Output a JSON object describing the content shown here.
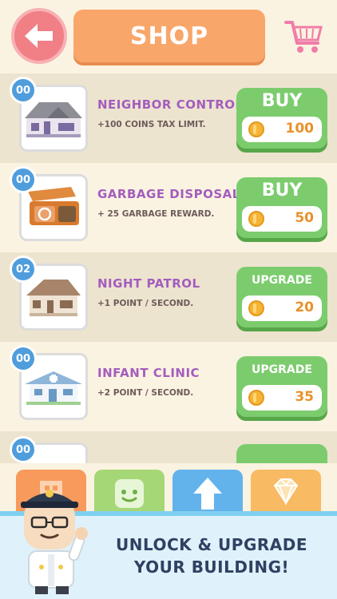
{
  "header": {
    "title": "SHOP",
    "back_icon": "arrow-left-icon",
    "cart_icon": "cart-icon"
  },
  "items": [
    {
      "count": "00",
      "name": "NEIGHBOR CONTROL",
      "desc": "+100 COINS TAX LIMIT.",
      "action": "BUY",
      "price": "100",
      "icon": "house-icon"
    },
    {
      "count": "00",
      "name": "GARBAGE DISPOSAL",
      "desc": "+ 25 GARBAGE REWARD.",
      "action": "BUY",
      "price": "50",
      "icon": "dumpster-icon"
    },
    {
      "count": "02",
      "name": "NIGHT PATROL",
      "desc": "+1 POINT / SECOND.",
      "action": "UPGRADE",
      "price": "20",
      "icon": "house-icon"
    },
    {
      "count": "00",
      "name": "INFANT CLINIC",
      "desc": "+2 POINT / SECOND.",
      "action": "UPGRADE",
      "price": "35",
      "icon": "clinic-icon"
    }
  ],
  "partial_item": {
    "count": "00"
  },
  "tabs": [
    {
      "icon": "building-icon"
    },
    {
      "icon": "smiley-icon"
    },
    {
      "icon": "arrow-up-icon"
    },
    {
      "icon": "diamond-icon"
    }
  ],
  "banner": {
    "line1": "UNLOCK & UPGRADE",
    "line2": "YOUR BUILDING!"
  },
  "colors": {
    "background": "#fbf3e1",
    "title_bg": "#f9a66b",
    "buy_bg": "#7ccc6e",
    "name_text": "#a35dbe",
    "price_text": "#e8912b"
  }
}
